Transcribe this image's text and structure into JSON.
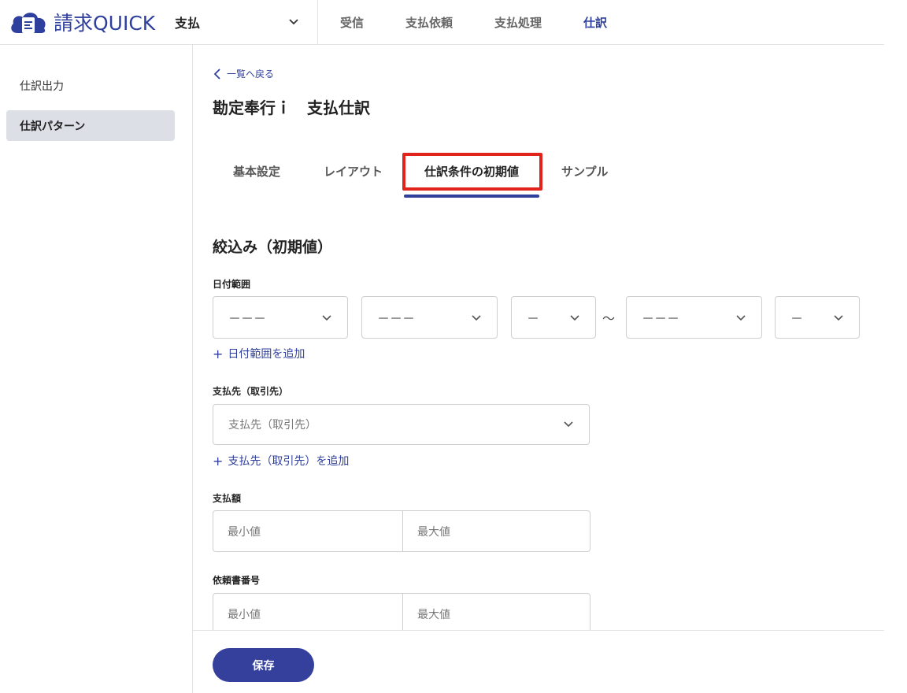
{
  "app": {
    "name": "請求QUICK",
    "module": "支払"
  },
  "nav": [
    "受信",
    "支払依頼",
    "支払処理",
    "仕訳"
  ],
  "nav_active": "仕訳",
  "sidebar": {
    "items": [
      {
        "label": "仕訳出力"
      },
      {
        "label": "仕訳パターン"
      }
    ]
  },
  "page": {
    "back_label": "一覧へ戻る",
    "title": "勘定奉行ｉ　支払仕訳",
    "tabs": [
      "基本設定",
      "レイアウト",
      "仕訳条件の初期値",
      "サンプル"
    ],
    "active_tab": "仕訳条件の初期値"
  },
  "form": {
    "section_title": "絞込み（初期値）",
    "date_range": {
      "label": "日付範囲",
      "selects": [
        "－－－",
        "－－－",
        "－",
        "－－－",
        "－"
      ],
      "separator": "〜",
      "add_label": "日付範囲を追加"
    },
    "payee": {
      "label": "支払先（取引先）",
      "placeholder": "支払先（取引先）",
      "add_label": "支払先（取引先）を追加"
    },
    "amount": {
      "label": "支払額",
      "min_placeholder": "最小値",
      "max_placeholder": "最大値"
    },
    "request_number": {
      "label": "依頼書番号",
      "min_placeholder": "最小値",
      "max_placeholder": "最大値"
    }
  },
  "footer": {
    "save_label": "保存"
  },
  "colors": {
    "brand": "#2f3f9e",
    "highlight": "#e0231b",
    "sidebar_active": "#dcdfe6"
  }
}
